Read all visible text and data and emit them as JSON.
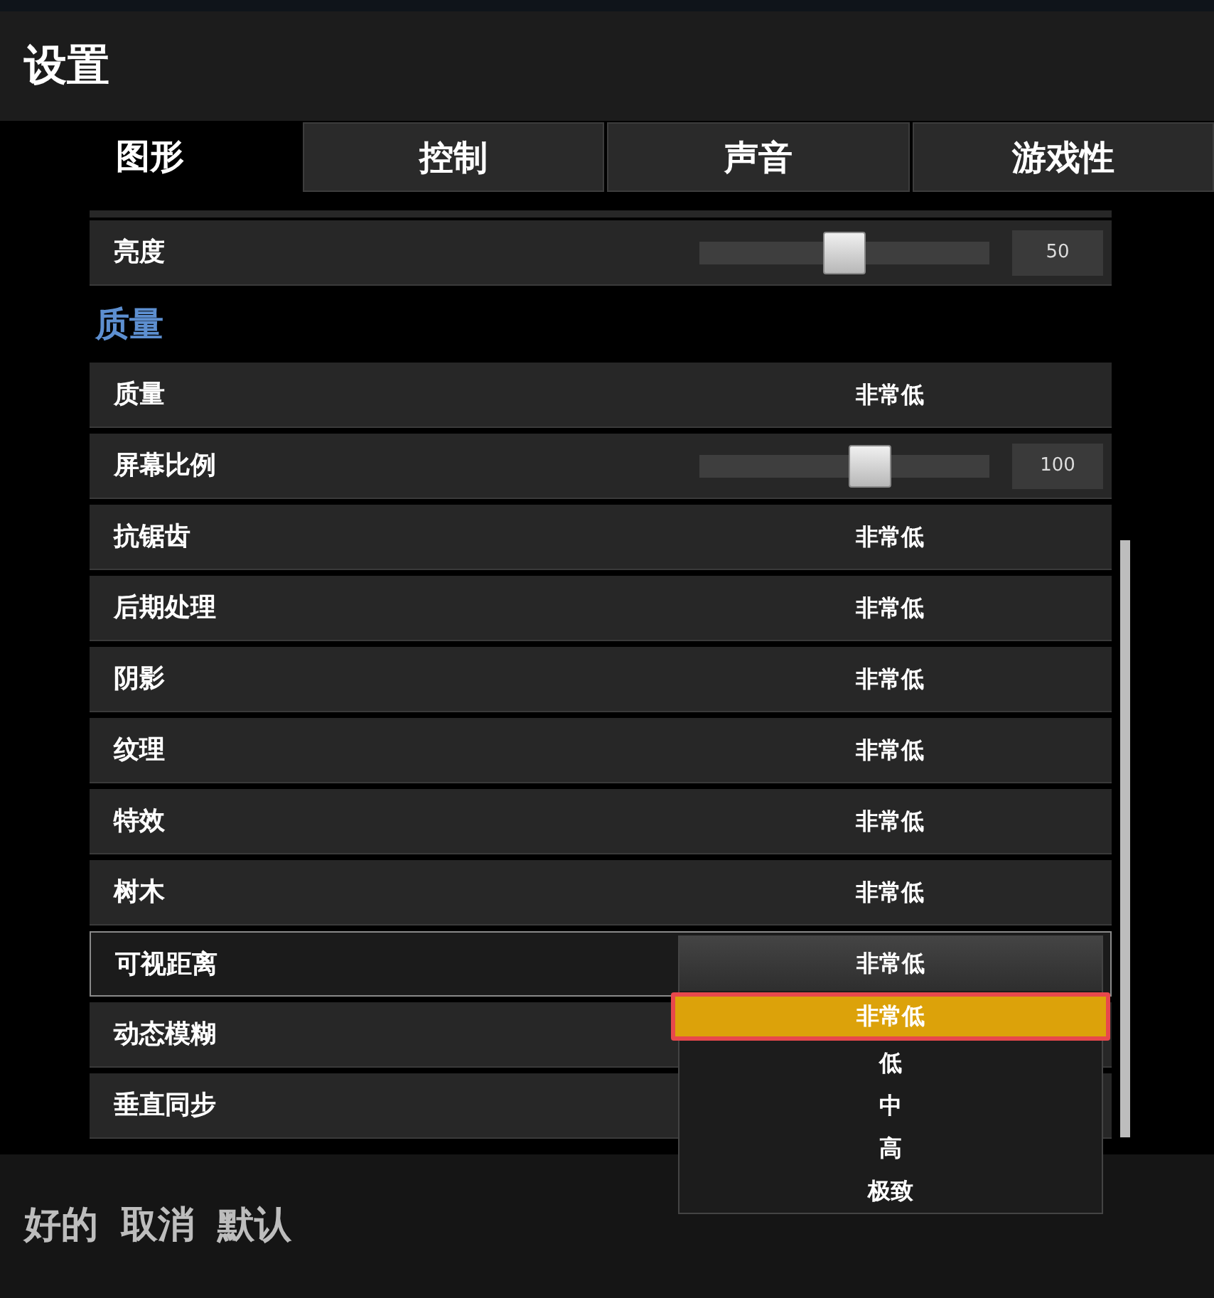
{
  "window": {
    "title": "设置"
  },
  "tabs": [
    {
      "label": "图形",
      "selected": true
    },
    {
      "label": "控制",
      "selected": false
    },
    {
      "label": "声音",
      "selected": false
    },
    {
      "label": "游戏性",
      "selected": false
    }
  ],
  "settings": [
    {
      "kind": "slider",
      "label": "亮度",
      "level": 0.5,
      "reading": "50"
    },
    {
      "kind": "heading",
      "label": "质量"
    },
    {
      "kind": "select",
      "label": "质量",
      "value": "非常低"
    },
    {
      "kind": "slider",
      "label": "屏幕比例",
      "level": 0.59,
      "reading": "100"
    },
    {
      "kind": "select",
      "label": "抗锯齿",
      "value": "非常低"
    },
    {
      "kind": "select",
      "label": "后期处理",
      "value": "非常低"
    },
    {
      "kind": "select",
      "label": "阴影",
      "value": "非常低"
    },
    {
      "kind": "select",
      "label": "纹理",
      "value": "非常低"
    },
    {
      "kind": "select",
      "label": "特效",
      "value": "非常低"
    },
    {
      "kind": "select",
      "label": "树木",
      "value": "非常低"
    },
    {
      "kind": "dropdown",
      "label": "可视距离",
      "value": "非常低",
      "options": [
        {
          "label": "非常低",
          "selected": true
        },
        {
          "label": "低",
          "selected": false
        },
        {
          "label": "中",
          "selected": false
        },
        {
          "label": "高",
          "selected": false
        },
        {
          "label": "极致",
          "selected": false
        }
      ]
    },
    {
      "kind": "select",
      "label": "动态模糊"
    },
    {
      "kind": "select",
      "label": "垂直同步"
    }
  ],
  "footer_buttons": [
    "好的",
    "取消",
    "默认"
  ]
}
